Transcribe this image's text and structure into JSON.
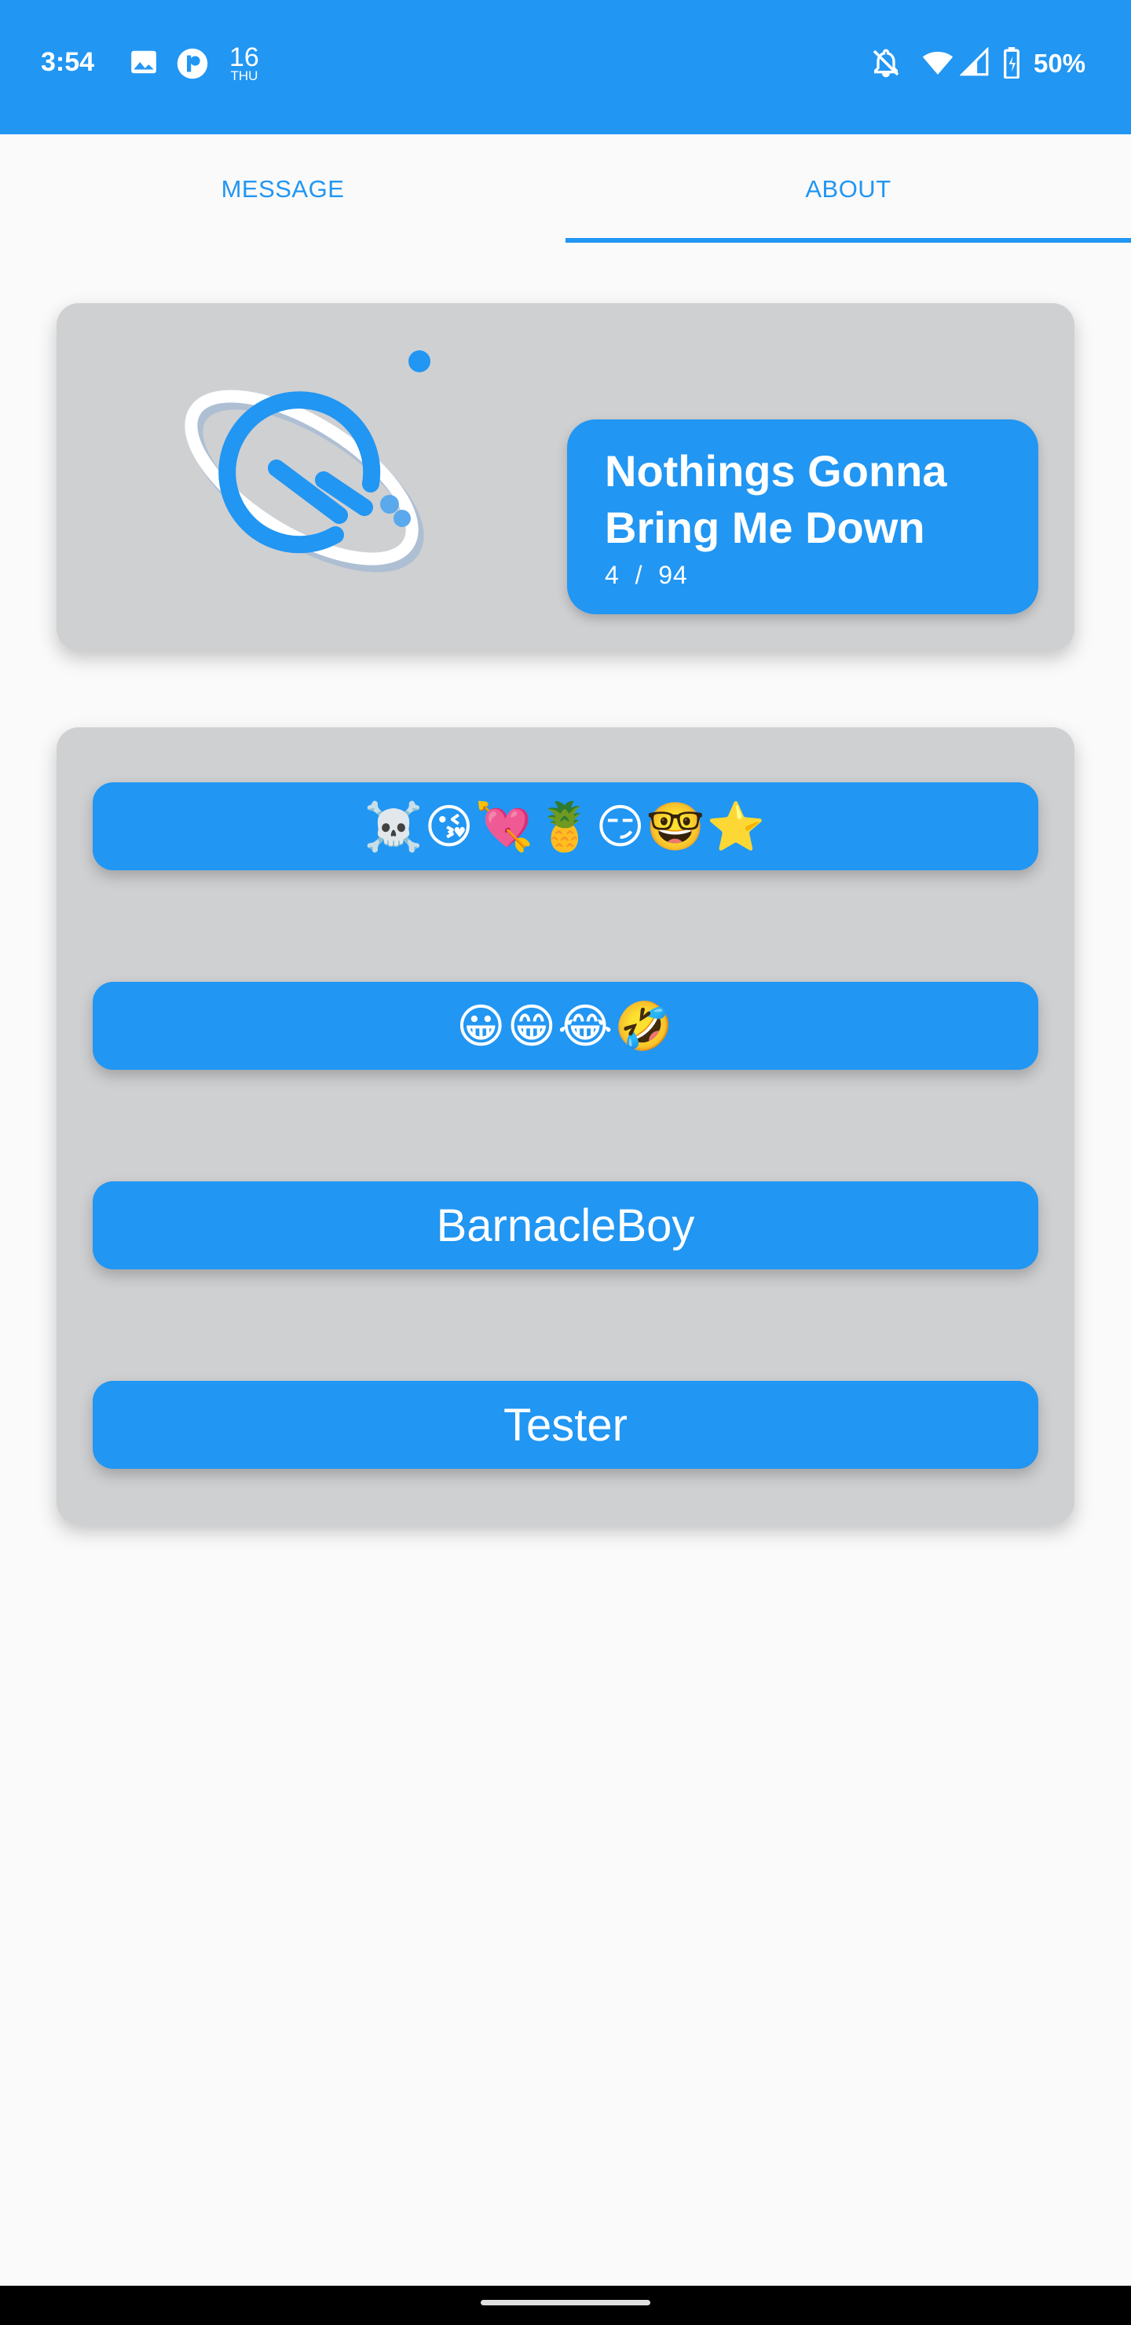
{
  "status_bar": {
    "time": "3:54",
    "date_day": "16",
    "date_weekday": "THU",
    "battery": "50%",
    "icons": [
      "image-icon",
      "app-notification-icon",
      "notifications-off-icon",
      "wifi-icon",
      "cell-signal-icon",
      "battery-charging-icon"
    ],
    "color": "#2196f3"
  },
  "tabs": [
    {
      "label": "MESSAGE",
      "selected": false
    },
    {
      "label": "ABOUT",
      "selected": true
    }
  ],
  "header_card": {
    "logo_icon": "planet-chat-logo-icon",
    "title": "Nothings Gonna Bring Me Down",
    "count": {
      "current": "4",
      "separator": "/",
      "total": "94"
    }
  },
  "users": [
    {
      "label": "☠️😘💘🍍😏🤓⭐"
    },
    {
      "label": "😀😁😂🤣"
    },
    {
      "label": "BarnacleBoy"
    },
    {
      "label": "Tester"
    }
  ],
  "colors": {
    "accent": "#2196f3",
    "card": "#cfd0d2",
    "background": "#fafafa"
  }
}
